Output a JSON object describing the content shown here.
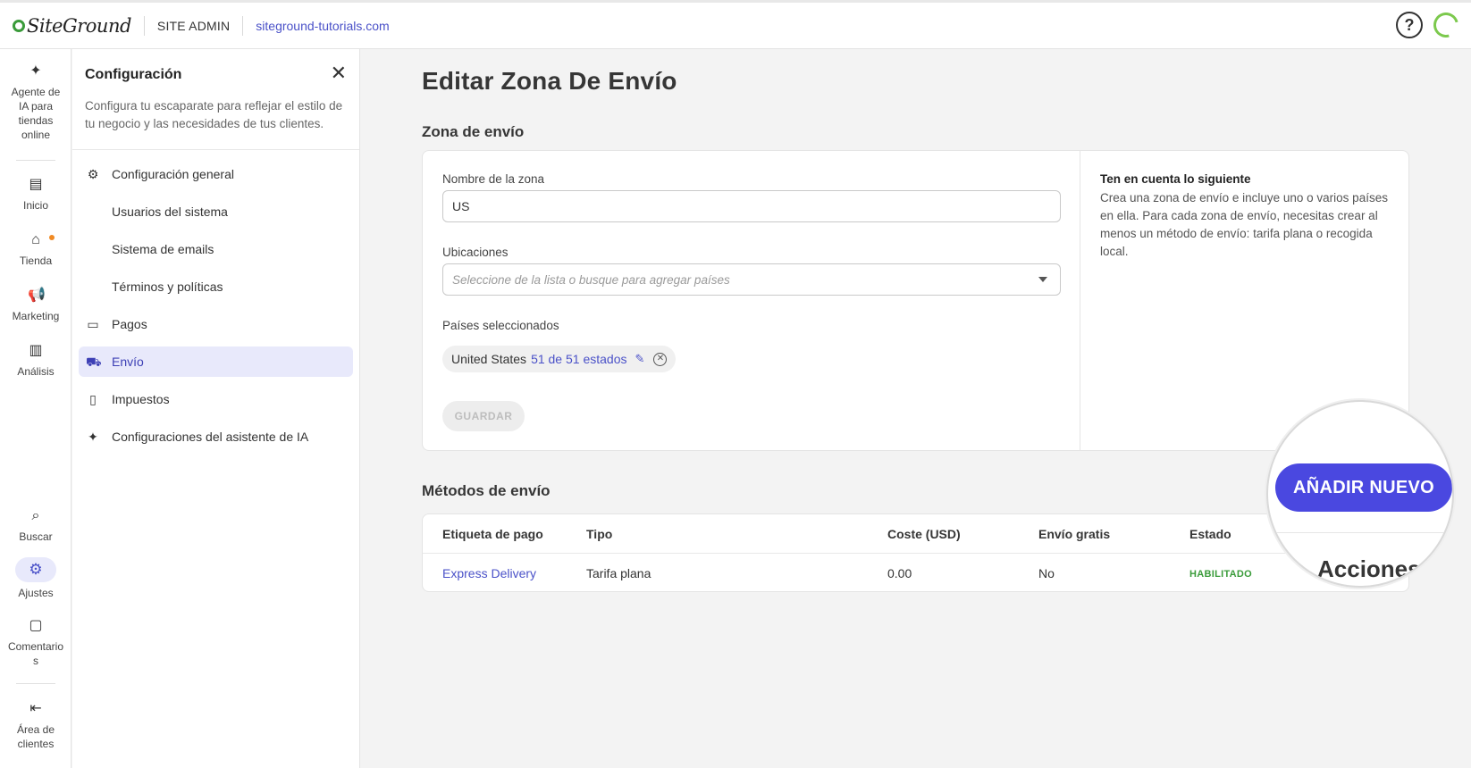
{
  "topbar": {
    "logo_text": "SiteGround",
    "site_admin": "SITE ADMIN",
    "domain": "siteground-tutorials.com",
    "help_icon": "question-circle-icon"
  },
  "rail": {
    "items": [
      {
        "label": "Agente de IA para tiendas online",
        "icon": "sparkle-icon"
      },
      {
        "label": "Inicio",
        "icon": "dashboard-icon"
      },
      {
        "label": "Tienda",
        "icon": "store-icon"
      },
      {
        "label": "Marketing",
        "icon": "megaphone-icon"
      },
      {
        "label": "Análisis",
        "icon": "chart-icon"
      },
      {
        "label": "Buscar",
        "icon": "search-icon"
      },
      {
        "label": "Ajustes",
        "icon": "gear-icon"
      },
      {
        "label": "Comentarios",
        "icon": "feedback-icon"
      },
      {
        "label": "Área de clientes",
        "icon": "exit-icon"
      }
    ]
  },
  "panel": {
    "title": "Configuración",
    "description": "Configura tu escaparate para reflejar el estilo de tu negocio y las necesidades de tus clientes.",
    "menu": [
      {
        "label": "Configuración general",
        "icon": "gear-icon"
      },
      {
        "label": "Usuarios del sistema"
      },
      {
        "label": "Sistema de emails"
      },
      {
        "label": "Términos y políticas"
      },
      {
        "label": "Pagos",
        "icon": "card-icon"
      },
      {
        "label": "Envío",
        "icon": "truck-icon",
        "active": true
      },
      {
        "label": "Impuestos",
        "icon": "document-icon"
      },
      {
        "label": "Configuraciones del asistente de IA",
        "icon": "sparkle-icon"
      }
    ]
  },
  "main": {
    "title": "Editar Zona De Envío",
    "zone_section_title": "Zona de envío",
    "zone_name_label": "Nombre de la zona",
    "zone_name_value": "US",
    "locations_label": "Ubicaciones",
    "locations_placeholder": "Seleccione de la lista o busque para agregar países",
    "selected_label": "Países seleccionados",
    "chip_country": "United States",
    "chip_states": "51 de 51 estados",
    "save_button": "GUARDAR",
    "note_title": "Ten en cuenta lo siguiente",
    "note_body": "Crea una zona de envío e incluye uno o varios países en ella. Para cada zona de envío, necesitas crear al menos un método de envío: tarifa plana o recogida local.",
    "methods_title": "Métodos de envío",
    "table": {
      "headers": [
        "Etiqueta de pago",
        "Tipo",
        "Coste (USD)",
        "Envío gratis",
        "Estado"
      ],
      "rows": [
        [
          "Express Delivery",
          "Tarifa plana",
          "0.00",
          "No",
          "HABILITADO"
        ]
      ]
    },
    "add_button": "AÑADIR NUEVO",
    "acciones": "Acciones"
  }
}
